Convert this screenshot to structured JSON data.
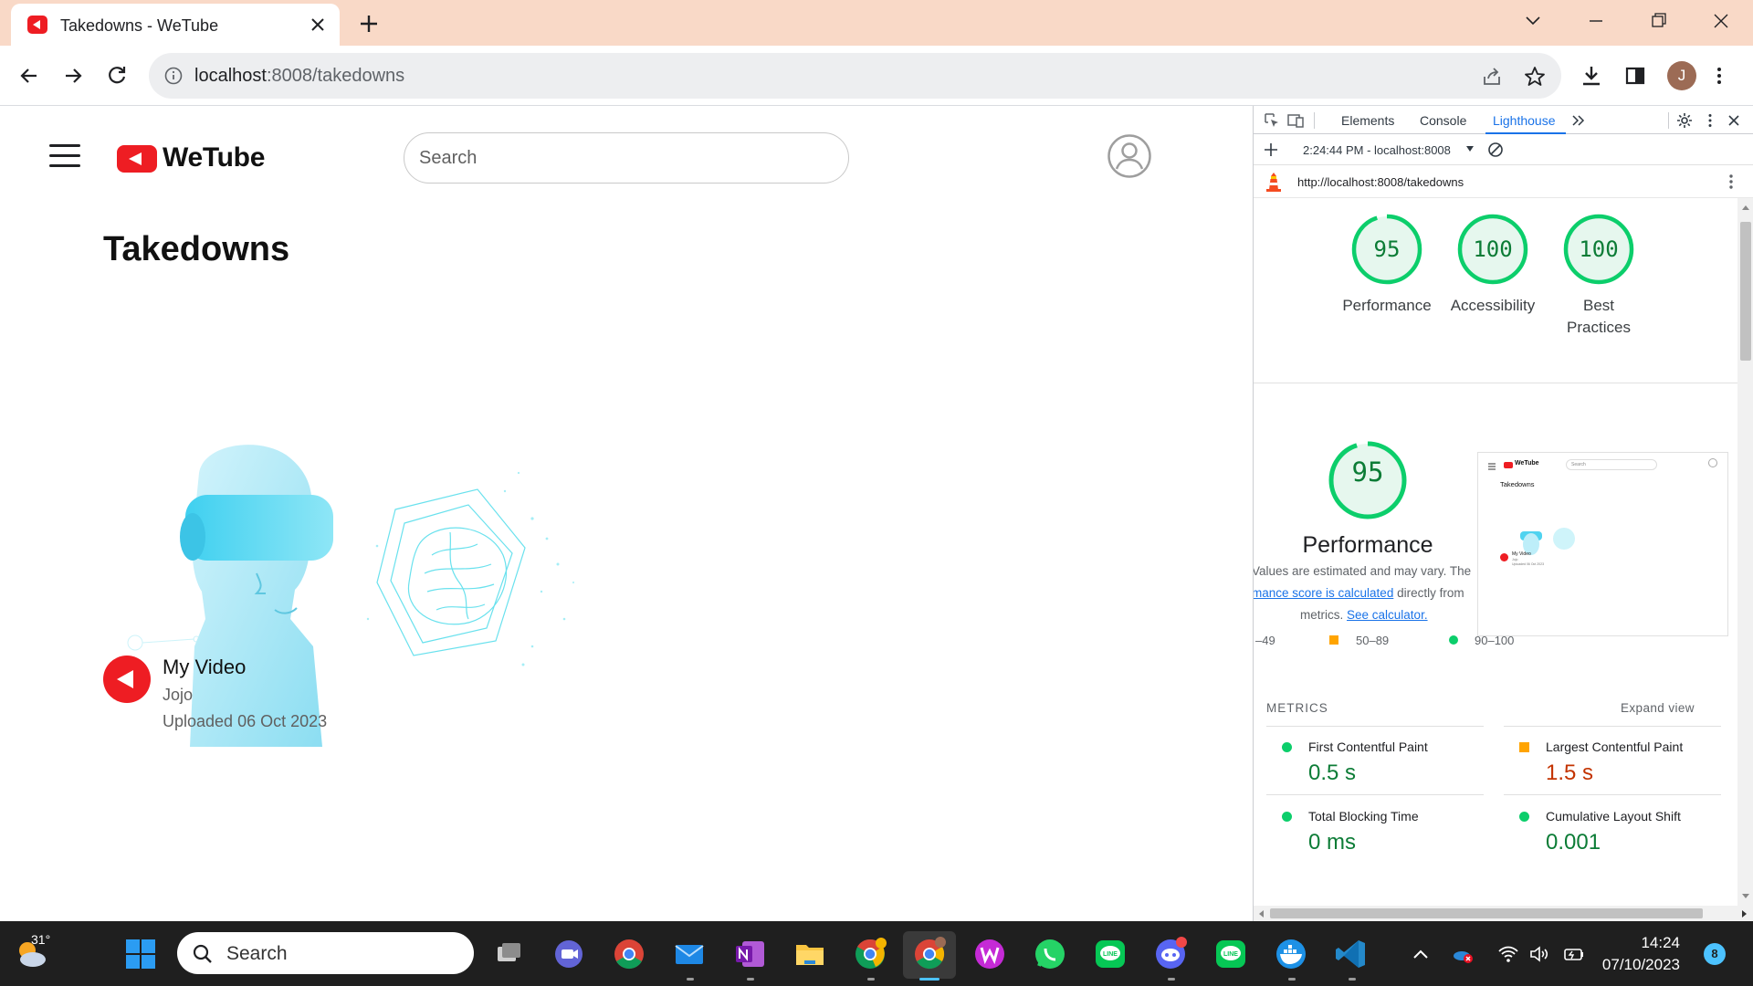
{
  "browser": {
    "tab_title": "Takedowns - WeTube",
    "url_host": "localhost",
    "url_path": ":8008/takedowns",
    "profile_initial": "J"
  },
  "page": {
    "logo_text": "WeTube",
    "search_placeholder": "Search",
    "title": "Takedowns",
    "video": {
      "title": "My Video",
      "channel": "Jojo",
      "uploaded": "Uploaded 06 Oct 2023"
    }
  },
  "devtools": {
    "tabs": [
      "Elements",
      "Console",
      "Lighthouse"
    ],
    "active_tab": "Lighthouse",
    "report_label": "2:24:44 PM - localhost:8008",
    "report_url": "http://localhost:8008/takedowns",
    "scores": [
      {
        "value": "95",
        "label": "Performance"
      },
      {
        "value": "100",
        "label": "Accessibility"
      },
      {
        "value": "100",
        "label": "Best Practices"
      }
    ],
    "performance": {
      "score": "95",
      "title": "Performance",
      "note_line1": "Values are estimated and may vary. The",
      "note_link": "mance score is calculated",
      "note_after_link": " directly from",
      "note_line3_pre": "metrics. ",
      "note_line3_link": "See calculator."
    },
    "legend": [
      "–49",
      "50–89",
      "90–100"
    ],
    "metrics_header": "METRICS",
    "expand_label": "Expand view",
    "metrics": [
      {
        "name": "First Contentful Paint",
        "value": "0.5 s",
        "status": "pass"
      },
      {
        "name": "Largest Contentful Paint",
        "value": "1.5 s",
        "status": "average"
      },
      {
        "name": "Total Blocking Time",
        "value": "0 ms",
        "status": "pass"
      },
      {
        "name": "Cumulative Layout Shift",
        "value": "0.001",
        "status": "pass"
      }
    ],
    "screenshot": {
      "logo": "WeTube",
      "search": "Search",
      "title": "Takedowns",
      "video_title": "My Video",
      "channel": "Jojo",
      "uploaded": "Uploaded 06 Oct 2023"
    }
  },
  "taskbar": {
    "temperature": "31°",
    "search_label": "Search",
    "time": "14:24",
    "date": "07/10/2023",
    "notifications": "8"
  },
  "colors": {
    "brand_red": "#ee1d23",
    "pass_green": "#0cce6b",
    "average_orange": "#ffa400",
    "accent_blue": "#1a73e8"
  }
}
